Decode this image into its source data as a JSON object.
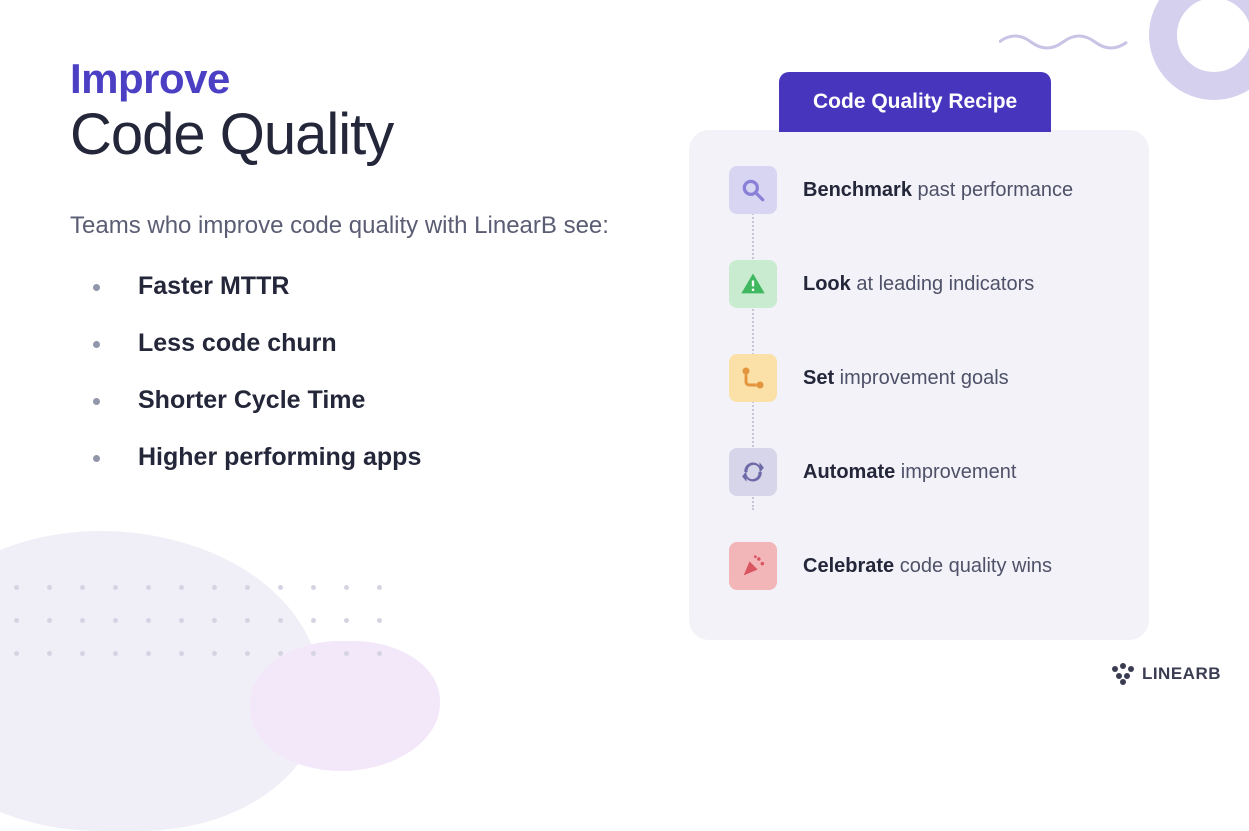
{
  "heading": {
    "eyebrow": "Improve",
    "title": "Code Quality",
    "subtext": "Teams who improve code quality with LinearB see:"
  },
  "benefits": [
    "Faster MTTR",
    "Less code churn",
    "Shorter Cycle Time",
    "Higher performing apps"
  ],
  "recipe": {
    "tab_label": "Code Quality Recipe",
    "steps": [
      {
        "bold": "Benchmark",
        "rest": " past performance",
        "icon": "magnify-icon",
        "icon_bg": "ic-lavender"
      },
      {
        "bold": "Look",
        "rest": " at leading indicators",
        "icon": "alert-icon",
        "icon_bg": "ic-green"
      },
      {
        "bold": "Set",
        "rest": " improvement goals",
        "icon": "route-icon",
        "icon_bg": "ic-yellow"
      },
      {
        "bold": "Automate",
        "rest": " improvement",
        "icon": "sync-icon",
        "icon_bg": "ic-blue"
      },
      {
        "bold": "Celebrate",
        "rest": " code quality wins",
        "icon": "confetti-icon",
        "icon_bg": "ic-pink"
      }
    ]
  },
  "brand": "LINEARB"
}
